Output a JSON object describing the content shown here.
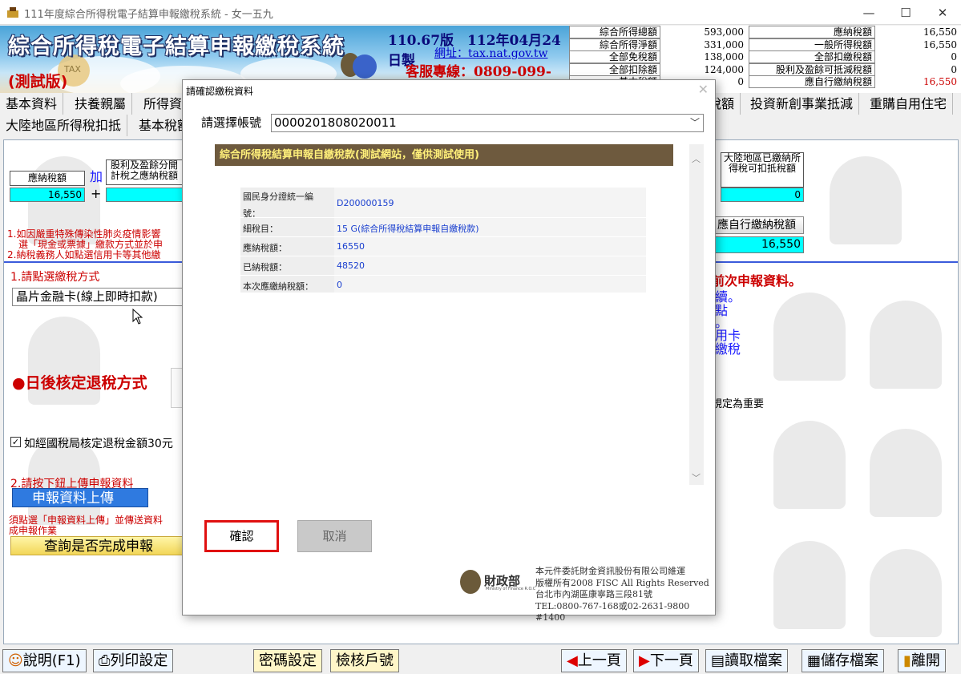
{
  "window": {
    "title": "111年度綜合所得稅電子結算申報繳稅系統 - 女一五九",
    "minimize": "—",
    "maximize": "☐",
    "close": "✕"
  },
  "banner": {
    "title": "綜合所得稅電子結算申報繳稅系統",
    "test": "(測試版)",
    "version": "110.67版　112年04月24日製",
    "website": "網址：tax.nat.gov.tw",
    "service": "客服專線：0809-099-089",
    "tax": "TAX"
  },
  "summary": {
    "left": [
      {
        "label": "綜合所得總額",
        "value": "593,000"
      },
      {
        "label": "綜合所得淨額",
        "value": "331,000"
      },
      {
        "label": "全部免稅額",
        "value": "138,000"
      },
      {
        "label": "全部扣除額",
        "value": "124,000"
      },
      {
        "label": "基本稅額",
        "value": "0"
      }
    ],
    "right": [
      {
        "label": "應納稅額",
        "value": "16,550"
      },
      {
        "label": "一般所得稅額",
        "value": "16,550"
      },
      {
        "label": "全部扣繳稅額",
        "value": "0"
      },
      {
        "label": "股利及盈餘可抵減稅額",
        "value": "0"
      },
      {
        "label": "應自行繳納稅額",
        "value": "16,550"
      }
    ]
  },
  "menu1": [
    "基本資料",
    "扶養親屬",
    "所得資",
    "稅額",
    "投資新創事業抵減",
    "重購自用住宅"
  ],
  "menu2": [
    "大陸地區所得稅扣抵",
    "基本稅額"
  ],
  "main": {
    "tax_label": "應納稅額",
    "tax_value": "16,550",
    "plus_word": "加",
    "plus": "+",
    "dividend_label": "股利及盈餘分開計稅之應納稅額",
    "mainland_label": "大陸地區已繳納所得稅可扣抵稅額",
    "mainland_value": "0",
    "self_pay_label": "應自行繳納稅額",
    "self_pay_value": "16,550",
    "note1": "1.如因嚴重特殊傳染性肺炎疫情影響",
    "note1b": "選「現金或票據」繳款方式並於申",
    "note2": "2.納稅義務人如點選信用卡等其他繳",
    "step1": "1.請點選繳稅方式",
    "pay_method": "晶片金融卡(線上即時扣款)",
    "refund_title": "●日後核定退稅方式",
    "checkbox_label": "如經國稅局核定退稅金額30元",
    "step2": "2.請按下鈕上傳申報資料",
    "upload_btn": "申報資料上傳",
    "note3": "須點選「申報資料上傳」並傳送資料",
    "note3b": "成申報作業",
    "query_btn": "查詢是否完成申報",
    "right_title": "前次申報資料。",
    "right_l1": "續。",
    "right_l2": "點",
    "right_l3": "。",
    "right_l4": "用卡",
    "right_l5": "繳稅",
    "right_l6": "規定為重要"
  },
  "dialog": {
    "title": "請確認繳稅資料",
    "close": "✕",
    "account_label": "請選擇帳號",
    "account_value": "0000201808020011",
    "header": "綜合所得稅結算申報自繳稅款(測試網站，僅供測試使用)",
    "rows": [
      {
        "k1": "國民身分證統一編",
        "k2": "號：",
        "v": "D200000159"
      },
      {
        "k1": "細稅目：",
        "k2": "",
        "v": "15 G(綜合所得稅結算申報自繳稅款)"
      },
      {
        "k1": "應納稅額：",
        "k2": "",
        "v": "16550"
      },
      {
        "k1": "已納稅額：",
        "k2": "",
        "v": "48520"
      },
      {
        "k1": "本次應繳納稅額：",
        "k2": "",
        "v": "0"
      }
    ],
    "confirm": "確認",
    "cancel": "取消",
    "mof": "財政部",
    "mof_en": "Ministry of Finance R.O.C",
    "footer": [
      "本元件委託財金資訊股份有限公司維運",
      "版權所有2008 FISC All Rights Reserved",
      "台北市內湖區康寧路三段81號",
      "TEL:0800-767-168或02-2631-9800 #1400"
    ]
  },
  "bottom": {
    "help": "說明(F1)",
    "print": "列印設定",
    "password": "密碼設定",
    "verify": "檢核戶號",
    "prev": "上一頁",
    "next": "下一頁",
    "read": "讀取檔案",
    "save": "儲存檔案",
    "exit": "離開"
  }
}
